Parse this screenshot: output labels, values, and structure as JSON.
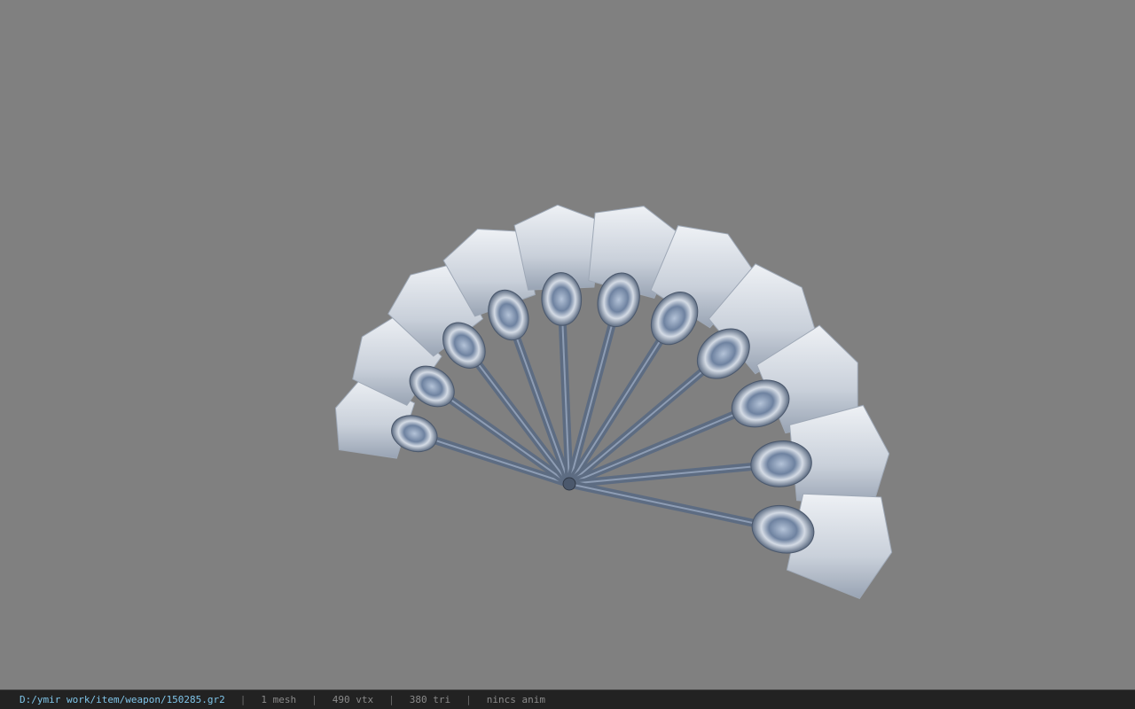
{
  "viewport": {
    "background_color": "#808080",
    "model": {
      "description_icon": "folding-fan-icon",
      "rib_color": "#5d6c82",
      "leaf_color": "#d7dde6",
      "leaf_shadow": "#9ea8b6",
      "ornament_color": "#8fa3bf",
      "rib_count": 11
    }
  },
  "status_bar": {
    "file_path": "D:/ymir work/item/weapon/150285.gr2",
    "separator": "|",
    "mesh_count": "1 mesh",
    "vertex_count": "490 vtx",
    "triangle_count": "380 tri",
    "animation": "nincs anim",
    "path_color": "#7fc4e8",
    "background_color": "#222222"
  }
}
